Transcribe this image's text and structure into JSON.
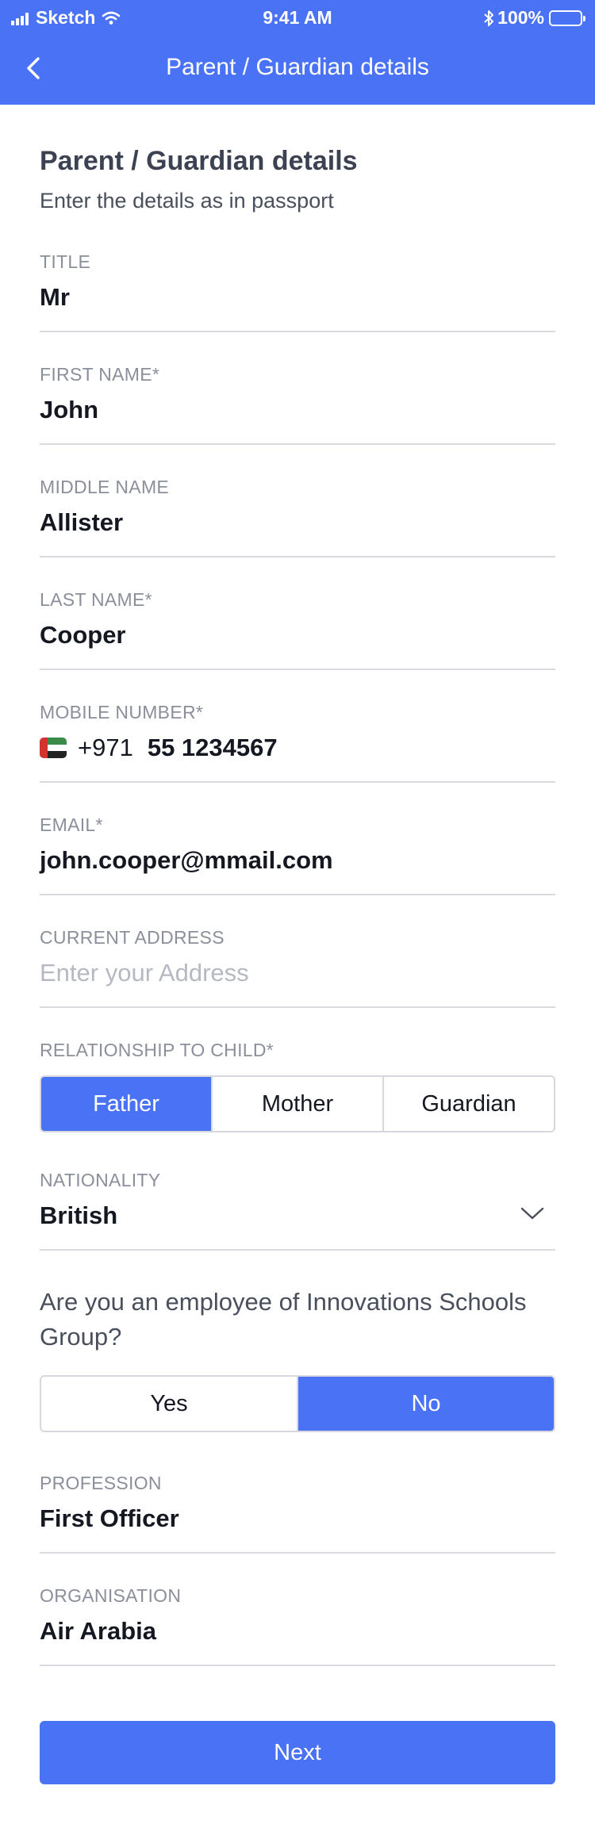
{
  "status_bar": {
    "carrier": "Sketch",
    "time": "9:41 AM",
    "battery": "100%"
  },
  "nav": {
    "title": "Parent / Guardian details",
    "back_icon": "chevron-left-icon"
  },
  "form": {
    "heading": "Parent / Guardian details",
    "subheading": "Enter the details as in passport",
    "title": {
      "label": "TITLE",
      "value": "Mr"
    },
    "first_name": {
      "label": "FIRST NAME*",
      "value": "John"
    },
    "middle_name": {
      "label": "MIDDLE NAME",
      "value": "Allister"
    },
    "last_name": {
      "label": "LAST NAME*",
      "value": "Cooper"
    },
    "mobile": {
      "label": "MOBILE NUMBER*",
      "dial_code": "+971",
      "value": "55 1234567",
      "flag_icon": "uae-flag-icon"
    },
    "email": {
      "label": "EMAIL*",
      "value": "john.cooper@mmail.com"
    },
    "address": {
      "label": "CURRENT ADDRESS",
      "placeholder": "Enter your Address"
    },
    "relationship": {
      "label": "RELATIONSHIP TO CHILD*",
      "options": [
        "Father",
        "Mother",
        "Guardian"
      ],
      "selected": "Father"
    },
    "nationality": {
      "label": "NATIONALITY",
      "value": "British",
      "icon": "chevron-down-icon"
    },
    "employee": {
      "question": "Are you an employee of Innovations Schools Group?",
      "options": [
        "Yes",
        "No"
      ],
      "selected": "No"
    },
    "profession": {
      "label": "PROFESSION",
      "value": "First Officer"
    },
    "organisation": {
      "label": "ORGANISATION",
      "value": "Air Arabia"
    },
    "next_label": "Next"
  },
  "colors": {
    "accent": "#4A72F5",
    "label": "#8b8f99",
    "divider": "#d9dbe0",
    "text": "#151821"
  }
}
